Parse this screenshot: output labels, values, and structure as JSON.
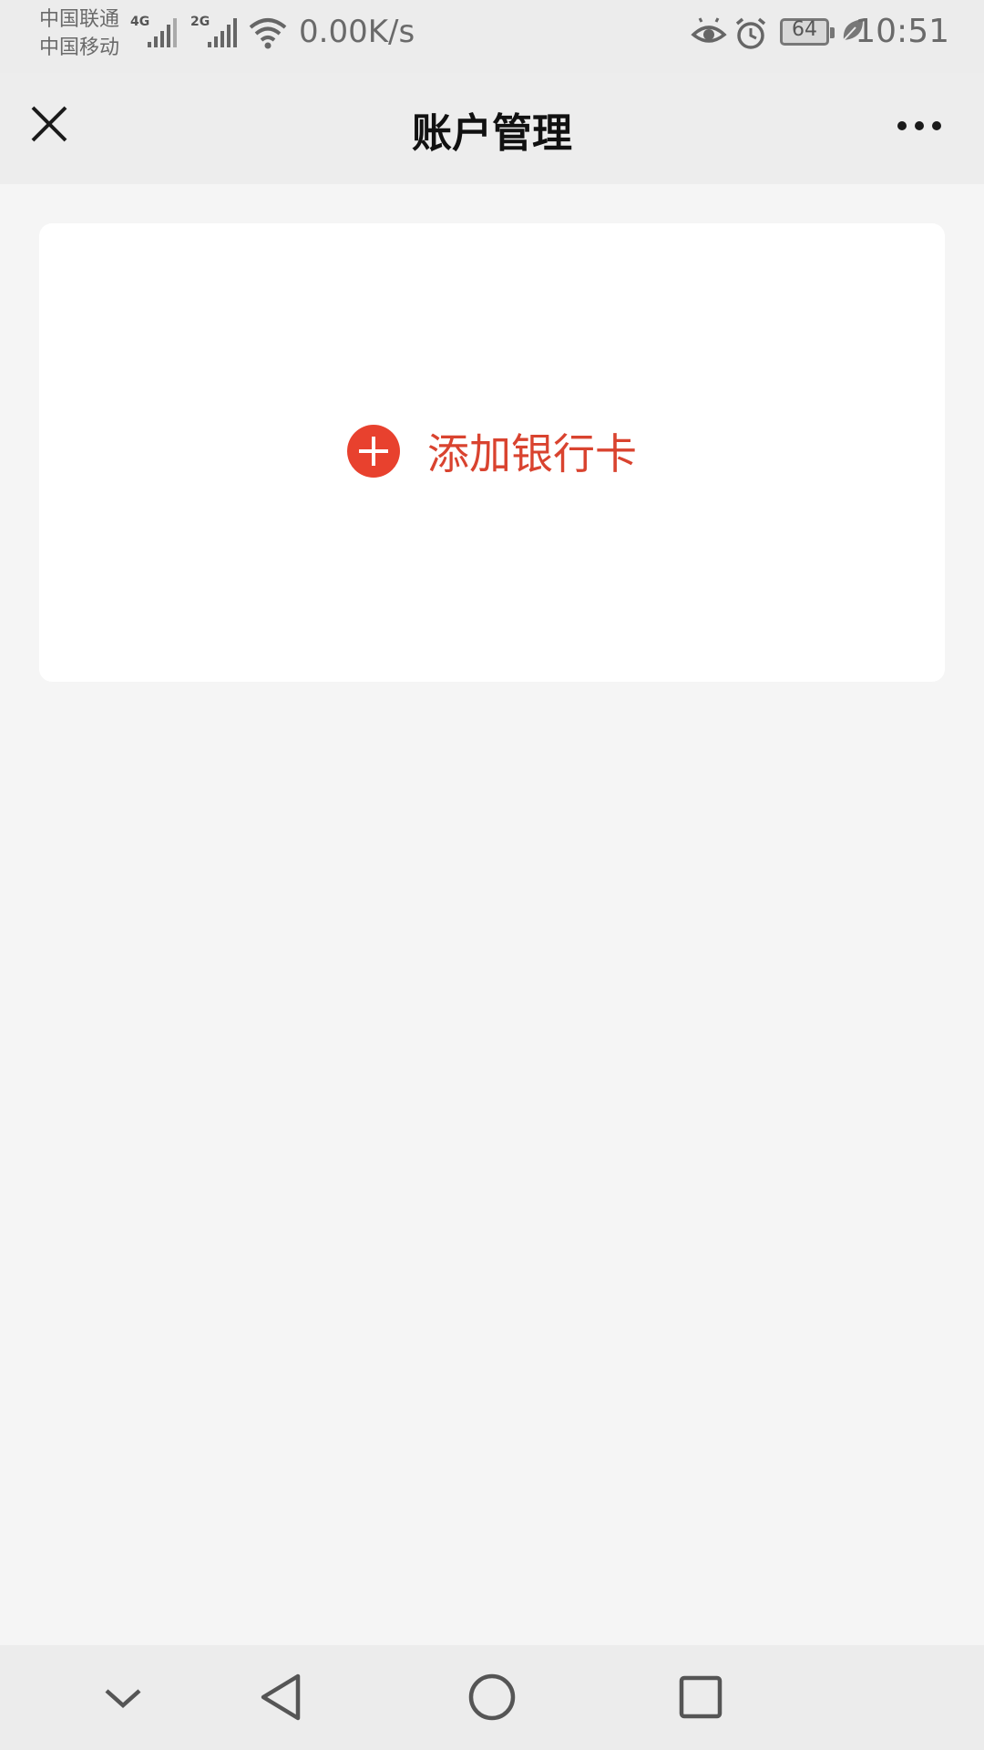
{
  "status_bar": {
    "carriers": [
      "中国联通",
      "中国移动"
    ],
    "network_1": "4G",
    "network_2": "2G",
    "net_speed": "0.00K/s",
    "battery_level": "64",
    "time": "10:51",
    "icons": [
      "signal-icon",
      "wifi-icon",
      "eye-icon",
      "alarm-icon",
      "battery-icon",
      "leaf-icon"
    ]
  },
  "header": {
    "title": "账户管理",
    "close_icon": "close-icon",
    "more_icon": "more-icon"
  },
  "card": {
    "add_bank_label": "添加银行卡",
    "add_icon": "plus-circle-icon"
  },
  "nav_bar": {
    "icons": [
      "chevron-down-icon",
      "back-triangle-icon",
      "home-circle-icon",
      "recents-square-icon"
    ]
  },
  "colors": {
    "accent": "#d9432f",
    "page_background": "#f5f5f5",
    "bar_background": "#ededed",
    "card_background": "#ffffff"
  }
}
